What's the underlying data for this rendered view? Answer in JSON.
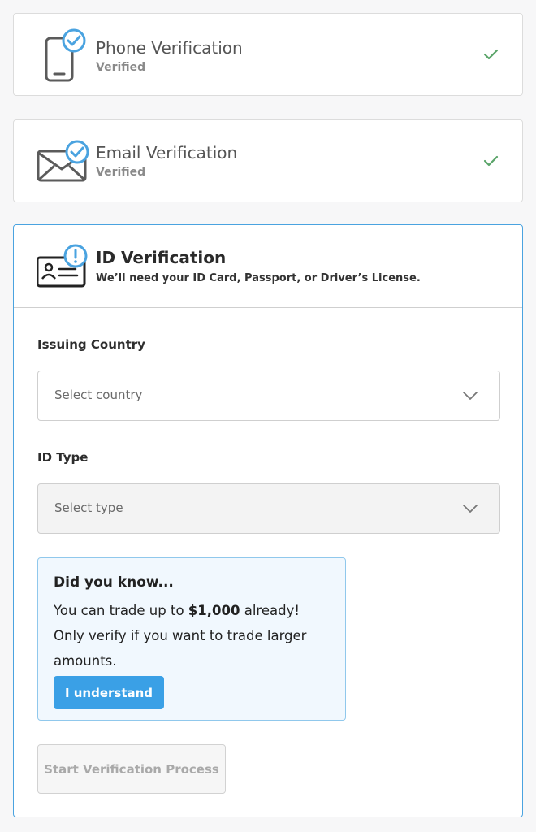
{
  "phone": {
    "title": "Phone Verification",
    "status": "Verified"
  },
  "email": {
    "title": "Email Verification",
    "status": "Verified"
  },
  "id": {
    "title": "ID Verification",
    "subtitle": "We’ll need your ID Card, Passport, or Driver’s License.",
    "country_label": "Issuing Country",
    "country_placeholder": "Select country",
    "type_label": "ID Type",
    "type_placeholder": "Select type",
    "info_title": "Did you know...",
    "info_prefix": "You can trade up to ",
    "info_amount": "$1,000",
    "info_suffix": " already! Only verify if you want to trade larger amounts.",
    "understand_label": "I understand",
    "start_label": "Start Verification Process"
  },
  "colors": {
    "accent": "#3aa0e6",
    "check": "#5aa469",
    "badge": "#4aa3e0"
  },
  "icons": [
    "phone-icon",
    "email-icon",
    "id-card-icon",
    "verified-badge-icon",
    "alert-badge-icon",
    "check-icon",
    "chevron-down-icon"
  ]
}
